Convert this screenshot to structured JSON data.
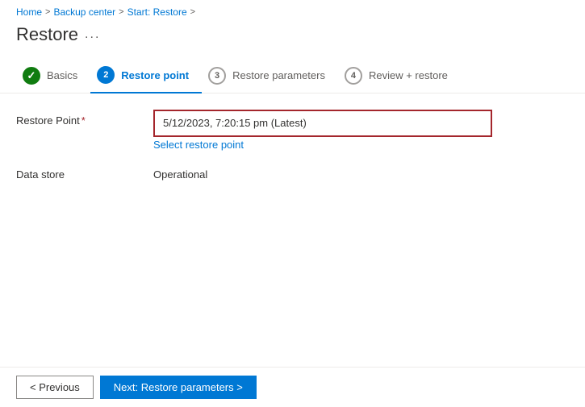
{
  "breadcrumb": {
    "items": [
      {
        "label": "Home",
        "href": "#"
      },
      {
        "label": "Backup center",
        "href": "#"
      },
      {
        "label": "Start: Restore",
        "href": "#"
      }
    ],
    "separator": ">"
  },
  "page": {
    "title": "Restore",
    "ellipsis": "..."
  },
  "wizard": {
    "tabs": [
      {
        "index": 1,
        "label": "Basics",
        "state": "completed"
      },
      {
        "index": 2,
        "label": "Restore point",
        "state": "active"
      },
      {
        "index": 3,
        "label": "Restore parameters",
        "state": "inactive"
      },
      {
        "index": 4,
        "label": "Review + restore",
        "state": "inactive"
      }
    ]
  },
  "form": {
    "restore_point_label": "Restore Point",
    "restore_point_required": "*",
    "restore_point_value": "5/12/2023, 7:20:15 pm (Latest)",
    "select_restore_link": "Select restore point",
    "data_store_label": "Data store",
    "data_store_value": "Operational"
  },
  "footer": {
    "previous_label": "< Previous",
    "next_label": "Next: Restore parameters >"
  }
}
